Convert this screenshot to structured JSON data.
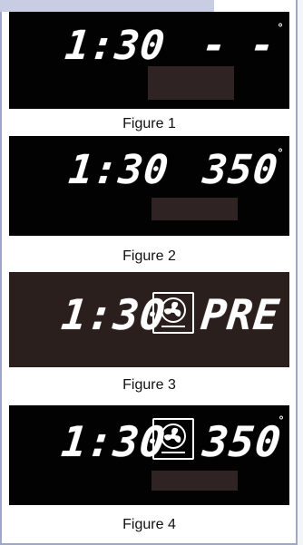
{
  "figures": [
    {
      "time": "1:30",
      "temperature": "- - -",
      "degree": "°",
      "caption": "Figure 1",
      "fan_icon": null
    },
    {
      "time": "1:30",
      "temperature": "350",
      "degree": "°",
      "caption": "Figure 2",
      "fan_icon": null
    },
    {
      "time": "1:30",
      "mode": "PRE",
      "caption": "Figure 3",
      "fan_icon": "convection-fan-icon"
    },
    {
      "time": "1:30",
      "temperature": "350",
      "degree": "°",
      "caption": "Figure 4",
      "fan_icon": "convection-fan-icon"
    }
  ],
  "colors": {
    "panel_black": "#020202",
    "panel_dark_brown": "#2b1f1d",
    "segment_white": "#ffffff",
    "inactive_window": "#2f2423",
    "frame_border": "#9fa7c9"
  }
}
